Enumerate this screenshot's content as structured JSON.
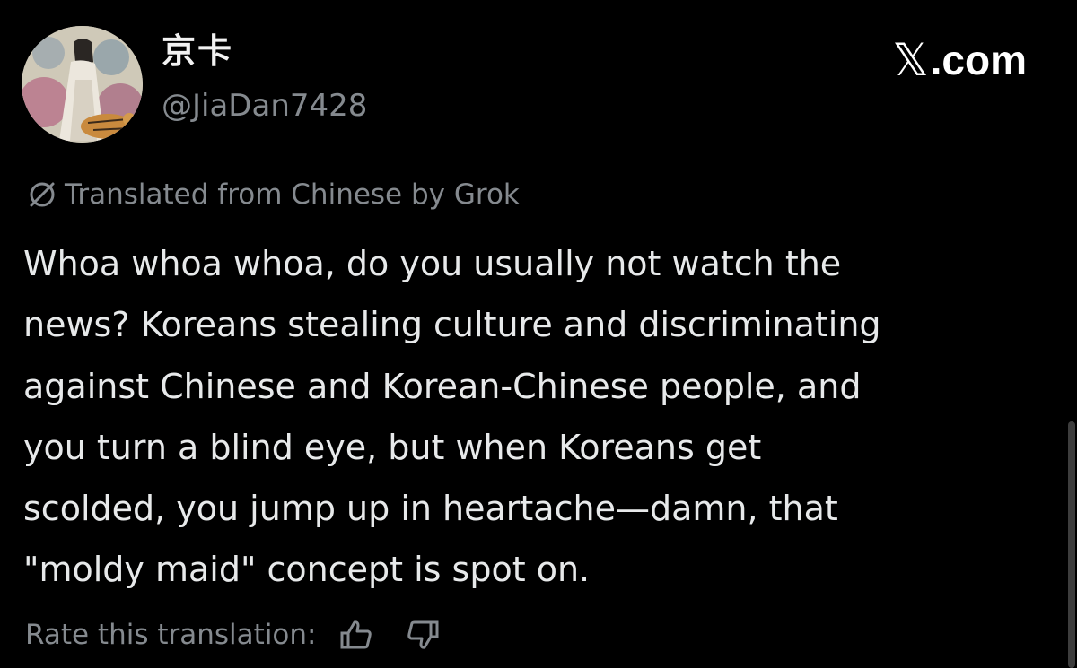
{
  "author": {
    "display_name": "京卡",
    "handle": "@JiaDan7428",
    "avatar_icon": "illustrated-figure-with-tiger-avatar"
  },
  "brand": {
    "text": ".com",
    "logo_icon": "x-logo-icon"
  },
  "translation_notice": {
    "icon": "translate-slash-icon",
    "text": "Translated from Chinese by Grok"
  },
  "tweet": {
    "lines": [
      "Whoa whoa whoa, do you usually not watch the",
      "news? Koreans stealing culture and discriminating",
      "against Chinese and Korean-Chinese people, and",
      "you turn a blind eye, but when Koreans get",
      "scolded, you jump up in heartache—damn, that",
      "\"moldy maid\" concept is spot on."
    ]
  },
  "rating": {
    "label": "Rate this translation:",
    "thumbs_up_icon": "thumbs-up-icon",
    "thumbs_down_icon": "thumbs-down-icon"
  },
  "colors": {
    "background": "#000000",
    "text_primary": "#e7e9ea",
    "text_secondary": "#858a8f"
  }
}
